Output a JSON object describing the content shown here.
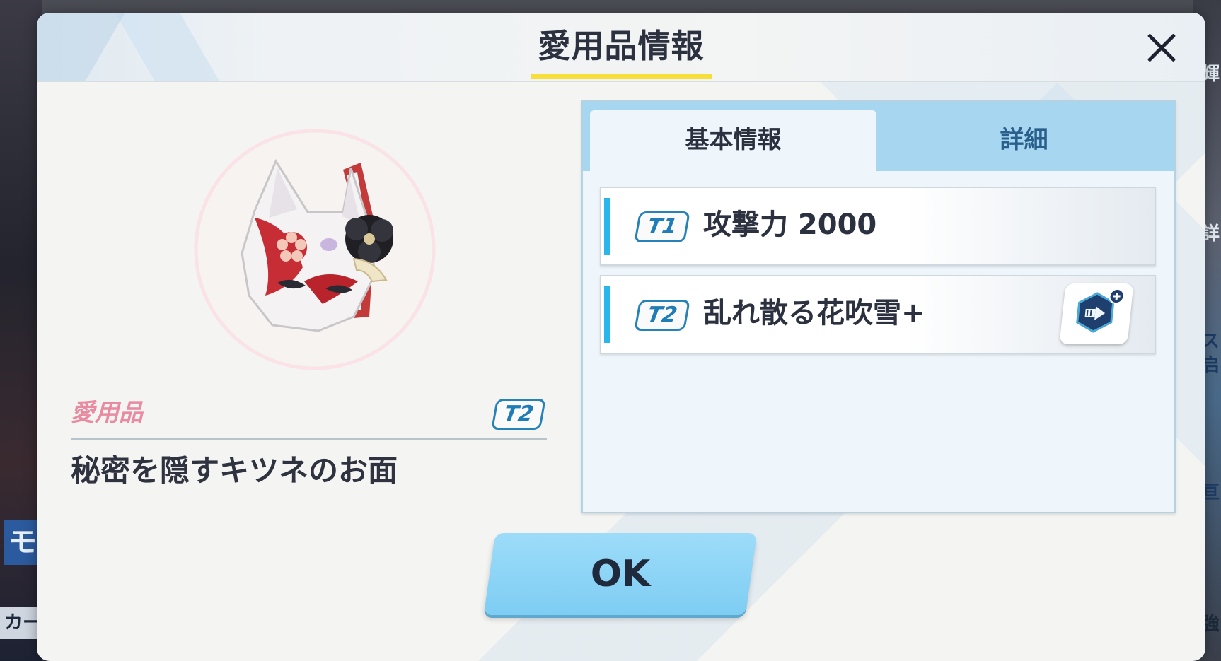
{
  "dialog": {
    "title": "愛用品情報",
    "close_icon": "close-icon"
  },
  "item": {
    "category": "愛用品",
    "tier": "T2",
    "name": "秘密を隠すキツネのお面",
    "image_icon": "kitsune-mask-icon"
  },
  "tabs": [
    {
      "label": "基本情報",
      "selected": true
    },
    {
      "label": "詳細",
      "selected": false
    }
  ],
  "effects": [
    {
      "tier": "T1",
      "text": "攻撃力 2000"
    },
    {
      "tier": "T2",
      "text": "乱れ散る花吹雪+",
      "skill_icon": "skill-upgrade-icon"
    }
  ],
  "ok_button": {
    "label": "OK"
  },
  "background": {
    "left_label_1": "モ",
    "left_label_2": "カー",
    "right_glyphs": [
      "輝",
      "詳",
      "ス",
      "启",
      "亘",
      "強"
    ]
  },
  "colors": {
    "accent_blue": "#29b6ea",
    "tab_bar": "#a6d6f0",
    "title_underline": "#f6df3b",
    "category_pink": "#e88aa0",
    "tier_blue": "#1f7cb6",
    "ok_button": "#8fd6f6"
  }
}
